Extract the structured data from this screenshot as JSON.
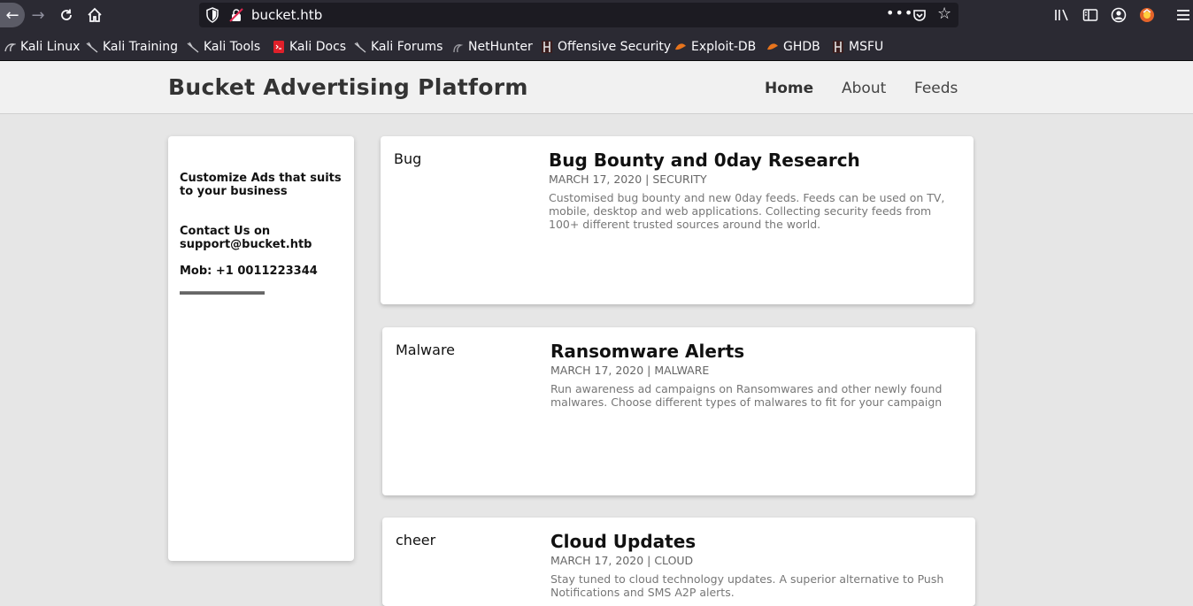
{
  "browser": {
    "url": "bucket.htb",
    "bookmarks": [
      {
        "label": "Kali Linux",
        "icon": "kali-dragon-icon"
      },
      {
        "label": "Kali Training",
        "icon": "kali-dragon-icon"
      },
      {
        "label": "Kali Tools",
        "icon": "kali-dragon-icon"
      },
      {
        "label": "Kali Docs",
        "icon": "kali-docs-icon"
      },
      {
        "label": "Kali Forums",
        "icon": "kali-dragon-icon"
      },
      {
        "label": "NetHunter",
        "icon": "nethunter-icon"
      },
      {
        "label": "Offensive Security",
        "icon": "offsec-icon"
      },
      {
        "label": "Exploit-DB",
        "icon": "exploitdb-icon"
      },
      {
        "label": "GHDB",
        "icon": "ghdb-icon"
      },
      {
        "label": "MSFU",
        "icon": "offsec-icon"
      }
    ]
  },
  "site": {
    "title": "Bucket Advertising Platform",
    "nav": [
      "Home",
      "About",
      "Feeds"
    ]
  },
  "sidebar": {
    "tagline": "Customize Ads that suits to your business",
    "contact": "Contact Us on support@bucket.htb",
    "mobile": "Mob: +1 0011223344"
  },
  "cards": [
    {
      "tag": "Bug",
      "title": "Bug Bounty and 0day Research",
      "meta": "MARCH 17, 2020 | SECURITY",
      "description": "Customised bug bounty and new 0day feeds. Feeds can be used on TV, mobile, desktop and web applications. Collecting security feeds from 100+ different trusted sources around the world."
    },
    {
      "tag": "Malware",
      "title": "Ransomware Alerts",
      "meta": "MARCH 17, 2020 | MALWARE",
      "description": "Run awareness ad campaigns on Ransomwares and other newly found malwares. Choose different types of malwares to fit for your campaign"
    },
    {
      "tag": "cheer",
      "title": "Cloud Updates",
      "meta": "MARCH 17, 2020 | CLOUD",
      "description": "Stay tuned to cloud technology updates. A superior alternative to Push Notifications and SMS A2P alerts."
    }
  ]
}
